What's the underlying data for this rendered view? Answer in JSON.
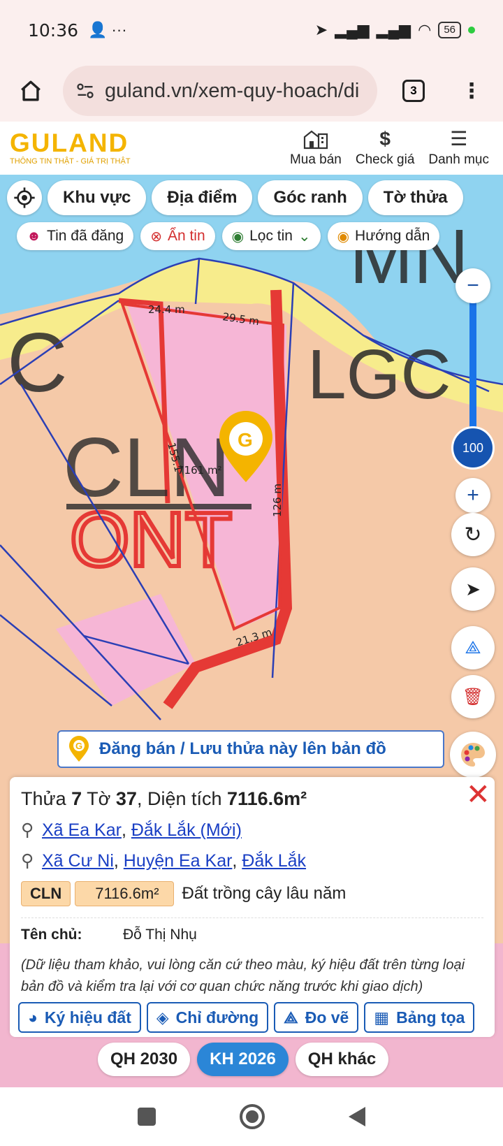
{
  "status_bar": {
    "time": "10:36",
    "left_icons": "👤 ···",
    "battery": "56"
  },
  "browser": {
    "url": "guland.vn/xem-quy-hoach/di",
    "tab_count": "3"
  },
  "app_header": {
    "logo_text": "GULAND",
    "logo_tagline": "THÔNG TIN THẬT - GIÁ TRỊ THẬT",
    "nav": [
      {
        "label": "Mua bán",
        "icon": "buildings-icon"
      },
      {
        "label": "Check giá",
        "icon": "dollar-icon"
      },
      {
        "label": "Danh mục",
        "icon": "menu-icon"
      }
    ]
  },
  "filters": {
    "primary": [
      "Khu vực",
      "Địa điểm",
      "Góc ranh",
      "Tờ thửa"
    ],
    "secondary": [
      {
        "label": "Tin đã đăng",
        "icon": "users-icon",
        "color": "#c2185b"
      },
      {
        "label": "Ẩn tin",
        "icon": "close-circle-icon",
        "color": "#d32f2f"
      },
      {
        "label": "Lọc tin",
        "icon": "pin-icon",
        "color": "#2e7d32"
      },
      {
        "label": "Hướng dẫn",
        "icon": "play-icon",
        "color": "#e08a00"
      }
    ]
  },
  "map": {
    "zoom_value": "100",
    "labels": {
      "edge_top_left": "24.4 m",
      "edge_top_right": "29.5 m",
      "edge_left": "155.1",
      "area": "7161 m²",
      "edge_right": "126 m",
      "edge_bottom": "21.3 m",
      "zone_a": "CLN",
      "zone_b": "ONT",
      "zone_c": "MN",
      "zone_d": "LGC"
    },
    "colors": {
      "base": "#f5c9a8",
      "water": "#8fd3f0",
      "yellow": "#f7ec8c",
      "pink": "#f6b6d6",
      "boundary": "#e53935"
    }
  },
  "save_banner": {
    "label": "Đăng bán / Lưu thửa này lên bản đồ"
  },
  "parcel": {
    "title_prefix": "Thửa",
    "parcel_no": "7",
    "sheet_prefix": "Tờ",
    "sheet_no": "37",
    "area_prefix": "Diện tích",
    "area": "7116.6m²",
    "location_new": {
      "commune": "Xã Ea Kar",
      "province": "Đắk Lắk (Mới)"
    },
    "location_old": {
      "commune": "Xã Cư Ni",
      "district": "Huyện Ea Kar",
      "province": "Đắk Lắk"
    },
    "land_code": "CLN",
    "land_area": "7116.6m²",
    "land_name": "Đất trồng cây lâu năm",
    "owner_label": "Tên chủ:",
    "owner_name": "Đỗ Thị Nhụ",
    "note": "(Dữ liệu tham khảo, vui lòng căn cứ theo màu, ký hiệu đất trên từng loại bản đồ và kiểm tra lại với cơ quan chức năng trước khi giao dịch)"
  },
  "actions": [
    {
      "label": "Ký hiệu đất",
      "icon": "palette-icon"
    },
    {
      "label": "Chỉ đường",
      "icon": "directions-icon"
    },
    {
      "label": "Đo vẽ",
      "icon": "measure-icon"
    },
    {
      "label": "Bảng tọa",
      "icon": "table-icon"
    }
  ],
  "plans": [
    {
      "label": "QH 2030",
      "active": false
    },
    {
      "label": "KH 2026",
      "active": true
    },
    {
      "label": "QH khác",
      "active": false
    }
  ]
}
